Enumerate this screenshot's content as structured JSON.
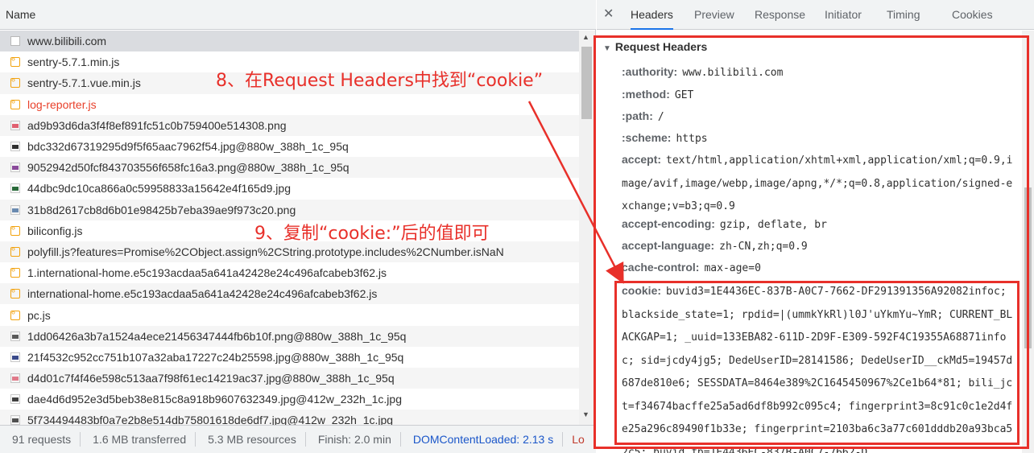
{
  "left_panel": {
    "name_header": "Name",
    "files": [
      {
        "name": "www.bilibili.com",
        "icon": "document-icon",
        "type": "doc",
        "selected": true
      },
      {
        "name": "sentry-5.7.1.min.js",
        "icon": "script-icon",
        "type": "js"
      },
      {
        "name": "sentry-5.7.1.vue.min.js",
        "icon": "script-icon",
        "type": "js"
      },
      {
        "name": "log-reporter.js",
        "icon": "script-icon",
        "type": "js",
        "error": true
      },
      {
        "name": "ad9b93d6da3f4f8ef891fc51c0b759400e514308.png",
        "icon": "image-icon",
        "type": "img",
        "color": "#e06070"
      },
      {
        "name": "bdc332d67319295d9f5f65aac7962f54.jpg@880w_388h_1c_95q",
        "icon": "image-icon",
        "type": "img",
        "color": "#303030"
      },
      {
        "name": "9052942d50fcf843703556f658fc16a3.png@880w_388h_1c_95q",
        "icon": "image-icon",
        "type": "img",
        "color": "#8a4a9a"
      },
      {
        "name": "44dbc9dc10ca866a0c59958833a15642e4f165d9.jpg",
        "icon": "image-icon",
        "type": "img",
        "color": "#2a6a3a"
      },
      {
        "name": "31b8d2617cb8d6b01e98425b7eba39ae9f973c20.png",
        "icon": "image-icon",
        "type": "img",
        "color": "#6a8ab0"
      },
      {
        "name": "biliconfig.js",
        "icon": "script-icon",
        "type": "js"
      },
      {
        "name": "polyfill.js?features=Promise%2CObject.assign%2CString.prototype.includes%2CNumber.isNaN",
        "icon": "script-icon",
        "type": "js"
      },
      {
        "name": "1.international-home.e5c193acdaa5a641a42428e24c496afcabeb3f62.js",
        "icon": "script-icon",
        "type": "js"
      },
      {
        "name": "international-home.e5c193acdaa5a641a42428e24c496afcabeb3f62.js",
        "icon": "script-icon",
        "type": "js"
      },
      {
        "name": "pc.js",
        "icon": "script-icon",
        "type": "js"
      },
      {
        "name": "1dd06426a3b7a1524a4ece21456347444fb6b10f.png@880w_388h_1c_95q",
        "icon": "image-icon",
        "type": "img",
        "color": "#5a5a5a"
      },
      {
        "name": "21f4532c952cc751b107a32aba17227c24b25598.jpg@880w_388h_1c_95q",
        "icon": "image-icon",
        "type": "img",
        "color": "#3a4a8a"
      },
      {
        "name": "d4d01c7f4f46e598c513aa7f98f61ec14219ac37.jpg@880w_388h_1c_95q",
        "icon": "image-icon",
        "type": "img",
        "color": "#e07a8a"
      },
      {
        "name": "dae4d6d952e3d5beb38e815c8a918b9607632349.jpg@412w_232h_1c.jpg",
        "icon": "image-icon",
        "type": "img",
        "color": "#404040"
      },
      {
        "name": "5f734494483bf0a7e2b8e514db75801618de6df7.jpg@412w_232h_1c.jpg",
        "icon": "image-icon",
        "type": "img",
        "color": "#505050"
      }
    ],
    "status": {
      "requests": "91 requests",
      "transferred": "1.6 MB transferred",
      "resources": "5.3 MB resources",
      "finish": "Finish: 2.0 min",
      "dom_loaded": "DOMContentLoaded: 2.13 s",
      "load": "Lo"
    }
  },
  "right_panel": {
    "close": "✕",
    "tabs": [
      "Headers",
      "Preview",
      "Response",
      "Initiator",
      "Timing",
      "Cookies"
    ],
    "active_tab": "Headers",
    "section_title": "Request Headers",
    "headers": [
      {
        "key": ":authority:",
        "value": "www.bilibili.com"
      },
      {
        "key": ":method:",
        "value": "GET"
      },
      {
        "key": ":path:",
        "value": "/"
      },
      {
        "key": ":scheme:",
        "value": "https"
      },
      {
        "key": "accept:",
        "value": "text/html,application/xhtml+xml,application/xml;q=0.9,image/avif,image/webp,image/apng,*/*;q=0.8,application/signed-exchange;v=b3;q=0.9"
      },
      {
        "key": "accept-encoding:",
        "value": "gzip, deflate, br"
      },
      {
        "key": "accept-language:",
        "value": "zh-CN,zh;q=0.9"
      },
      {
        "key": "cache-control:",
        "value": "max-age=0"
      }
    ],
    "cookie": {
      "key": "cookie:",
      "value": "buvid3=1E4436EC-837B-A0C7-7662-DF291391356A92082infoc; blackside_state=1; rpdid=|(ummkYkRl)l0J'uYkmYu~YmR; CURRENT_BLACKGAP=1; _uuid=133EBA82-611D-2D9F-E309-592F4C19355A68871infoc; sid=jcdy4jg5; DedeUserID=28141586; DedeUserID__ckMd5=19457d687de810e6; SESSDATA=8464e389%2C1645450967%2Ce1b64*81; bili_jct=f34674bacffe25a5ad6df8b992c095c4; fingerprint3=8c91c0c1e2d4fe25a296c89490f1b33e; fingerprint=2103ba6c3a77c601dddb20a93bca52c5; buvid_fp=1E4436EC-837B-A0C7-7662-D"
    }
  },
  "annotations": {
    "step8": "8、在Request Headers中找到“cookie”",
    "step9": "9、复制“cookie:”后的值即可",
    "color": "#e8302a"
  }
}
